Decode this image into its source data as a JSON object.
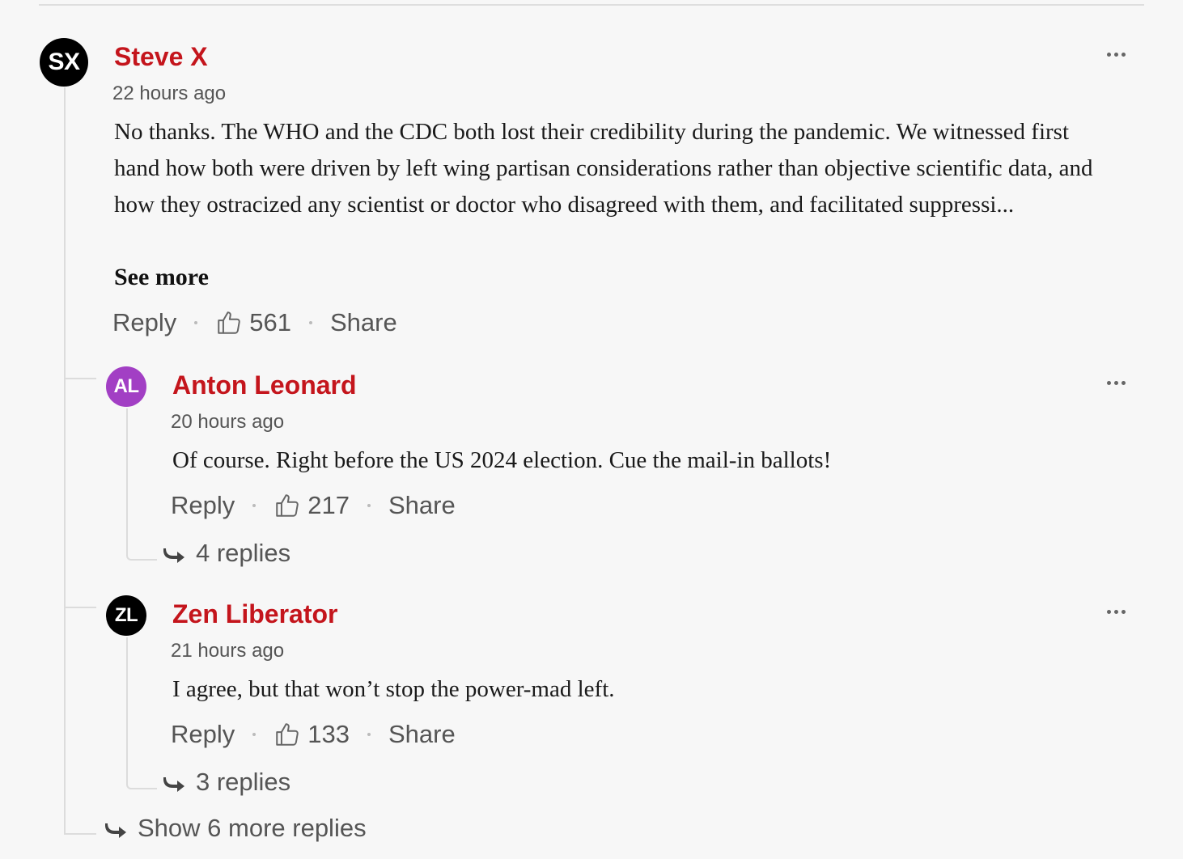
{
  "comments": {
    "main": {
      "initials": "SX",
      "avatar_color": "#000000",
      "author": "Steve X",
      "time": "22 hours ago",
      "text": "No thanks. The WHO and the CDC both lost their credibility during the pandemic. We witnessed first hand how both were driven by left wing partisan considerations rather than objective scientific data, and how they ostracized any scientist or doctor who disagreed with them, and facilitated suppressi...",
      "see_more": "See more",
      "reply_label": "Reply",
      "likes": "561",
      "share_label": "Share"
    },
    "replies": [
      {
        "initials": "AL",
        "avatar_color": "#a23fc4",
        "author": "Anton Leonard",
        "time": "20 hours ago",
        "text": "Of course. Right before the US 2024 election. Cue the mail-in ballots!",
        "reply_label": "Reply",
        "likes": "217",
        "share_label": "Share",
        "replies_count": "4 replies"
      },
      {
        "initials": "ZL",
        "avatar_color": "#000000",
        "author": "Zen Liberator",
        "time": "21 hours ago",
        "text": "I agree, but that won’t stop the power-mad left.",
        "reply_label": "Reply",
        "likes": "133",
        "share_label": "Share",
        "replies_count": "3 replies"
      }
    ],
    "show_more_replies": "Show 6 more replies"
  },
  "colors": {
    "author": "#c4151c",
    "muted": "#555555",
    "background": "#f7f7f7"
  }
}
